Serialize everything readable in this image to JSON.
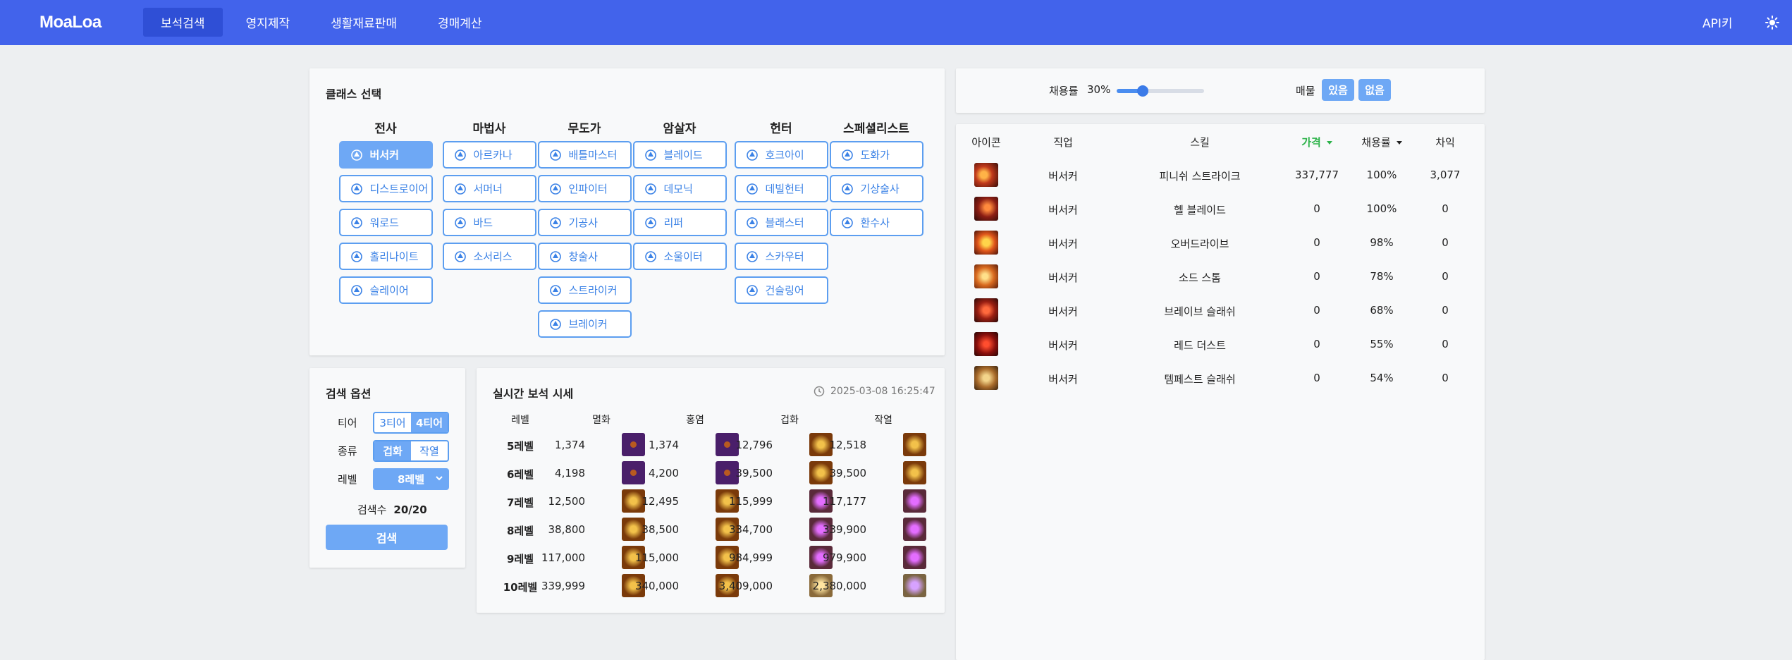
{
  "header": {
    "logo": "MoaLoa",
    "nav": [
      "보석검색",
      "영지제작",
      "생활재료판매",
      "경매계산"
    ],
    "api_label": "API키",
    "accent": "#4263eb"
  },
  "class_select": {
    "title": "클래스 선택",
    "groups": [
      {
        "name": "전사",
        "items": [
          "버서커",
          "디스트로이어",
          "워로드",
          "홀리나이트",
          "슬레이어"
        ]
      },
      {
        "name": "마법사",
        "items": [
          "아르카나",
          "서머너",
          "바드",
          "소서리스"
        ]
      },
      {
        "name": "무도가",
        "items": [
          "배틀마스터",
          "인파이터",
          "기공사",
          "창술사",
          "스트라이커",
          "브레이커"
        ]
      },
      {
        "name": "암살자",
        "items": [
          "블레이드",
          "데모닉",
          "리퍼",
          "소울이터"
        ]
      },
      {
        "name": "헌터",
        "items": [
          "호크아이",
          "데빌헌터",
          "블래스터",
          "스카우터",
          "건슬링어"
        ]
      },
      {
        "name": "스페셜리스트",
        "items": [
          "도화가",
          "기상술사",
          "환수사"
        ]
      }
    ],
    "selected": "버서커"
  },
  "search_options": {
    "title": "검색 옵션",
    "tier_label": "티어",
    "tier_options": [
      "3티어",
      "4티어"
    ],
    "tier_selected": "4티어",
    "kind_label": "종류",
    "kind_options": [
      "겁화",
      "작열"
    ],
    "kind_selected": "겁화",
    "level_label": "레벨",
    "level_value": "8레벨",
    "count_label": "검색수",
    "count_value": "20/20",
    "search_button": "검색"
  },
  "gem_prices": {
    "title": "실시간 보석 시세",
    "timestamp": "2025-03-08 16:25:47",
    "columns": [
      "레벨",
      "멸화",
      "홍염",
      "겁화",
      "작열"
    ],
    "rows": [
      {
        "level": "5레벨",
        "values": [
          "1,374",
          "1,374",
          "12,796",
          "12,518"
        ]
      },
      {
        "level": "6레벨",
        "values": [
          "4,198",
          "4,200",
          "39,500",
          "39,500"
        ]
      },
      {
        "level": "7레벨",
        "values": [
          "12,500",
          "12,495",
          "115,999",
          "117,177"
        ]
      },
      {
        "level": "8레벨",
        "values": [
          "38,800",
          "38,500",
          "334,700",
          "339,900"
        ]
      },
      {
        "level": "9레벨",
        "values": [
          "117,000",
          "115,000",
          "984,999",
          "979,900"
        ]
      },
      {
        "level": "10레벨",
        "values": [
          "339,999",
          "340,000",
          "3,409,000",
          "2,380,000"
        ]
      }
    ]
  },
  "rate_filter": {
    "rate_label": "채용률",
    "rate_value": "30%",
    "rate_fraction": 0.3,
    "sale_label": "매물",
    "sale_options": [
      "있음",
      "없음"
    ]
  },
  "skill_table": {
    "columns": [
      "아이콘",
      "직업",
      "스킬",
      "가격",
      "채용률",
      "차익"
    ],
    "sorted_column": "가격",
    "sorted_color": "#2db34a",
    "rows": [
      {
        "job": "버서커",
        "skill": "피니쉬 스트라이크",
        "price": "337,777",
        "rate": "100%",
        "diff": "3,077"
      },
      {
        "job": "버서커",
        "skill": "헬 블레이드",
        "price": "0",
        "rate": "100%",
        "diff": "0"
      },
      {
        "job": "버서커",
        "skill": "오버드라이브",
        "price": "0",
        "rate": "98%",
        "diff": "0"
      },
      {
        "job": "버서커",
        "skill": "소드 스톰",
        "price": "0",
        "rate": "78%",
        "diff": "0"
      },
      {
        "job": "버서커",
        "skill": "브레이브 슬래쉬",
        "price": "0",
        "rate": "68%",
        "diff": "0"
      },
      {
        "job": "버서커",
        "skill": "레드 더스트",
        "price": "0",
        "rate": "55%",
        "diff": "0"
      },
      {
        "job": "버서커",
        "skill": "템페스트 슬래쉬",
        "price": "0",
        "rate": "54%",
        "diff": "0"
      }
    ]
  }
}
